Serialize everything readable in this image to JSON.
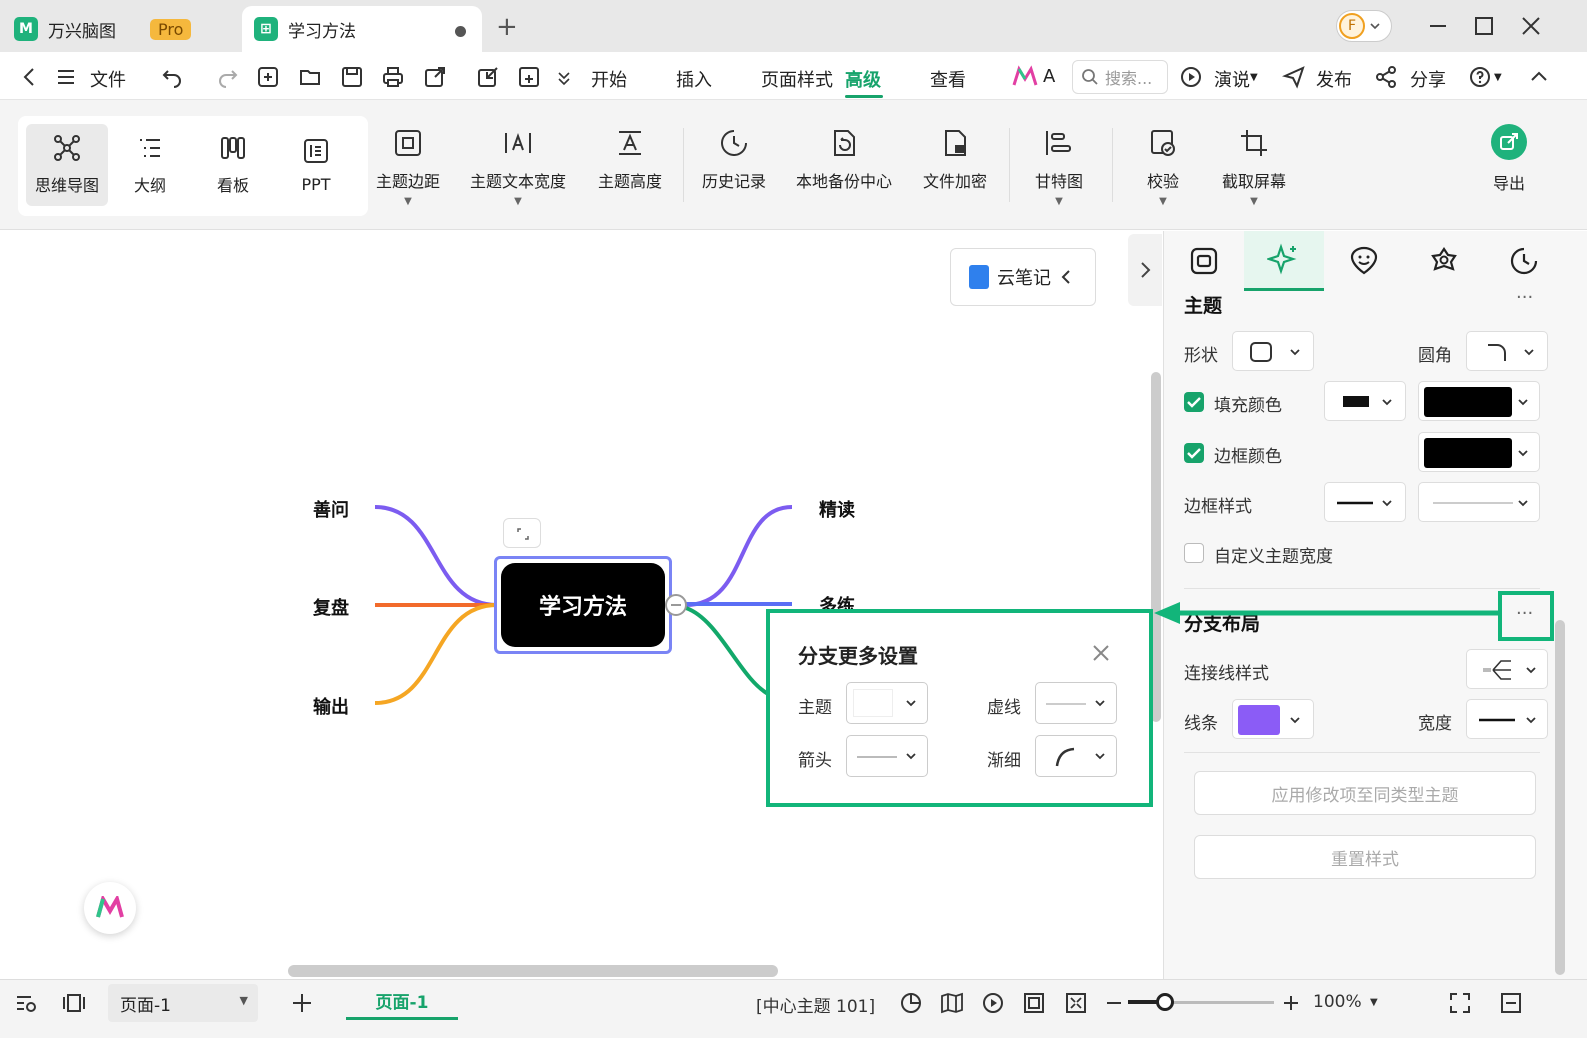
{
  "titlebar": {
    "home_tab": "万兴脑图",
    "pro_badge": "Pro",
    "doc_tab": "学习方法",
    "avatar_initial": "F"
  },
  "menubar": {
    "file": "文件",
    "tabs": [
      "开始",
      "插入",
      "页面样式",
      "高级",
      "查看"
    ],
    "active_tab": "高级",
    "ai_label": "A",
    "search_placeholder": "搜索...",
    "present": "演说",
    "publish": "发布",
    "share": "分享"
  },
  "ribbon": {
    "views": [
      "思维导图",
      "大纲",
      "看板",
      "PPT"
    ],
    "tools": [
      "主题边距",
      "主题文本宽度",
      "主题高度",
      "历史记录",
      "本地备份中心",
      "文件加密",
      "甘特图",
      "校验",
      "截取屏幕"
    ],
    "export": "导出"
  },
  "canvas": {
    "cloud_note": "云笔记",
    "central_topic": "学习方法",
    "branches_left": [
      "善问",
      "复盘",
      "输出"
    ],
    "branches_right": [
      "精读",
      "多练"
    ],
    "branch_colors": {
      "善问": "#7c5cf0",
      "复盘": "#f26b2b",
      "输出": "#f5a623",
      "精读": "#7c5cf0",
      "多练": "#5b6ef5",
      "third": "#12a86a"
    }
  },
  "popup": {
    "title": "分支更多设置",
    "topic_label": "主题",
    "dash_label": "虚线",
    "arrow_label": "箭头",
    "taper_label": "渐细"
  },
  "panel": {
    "topic_section": "主题",
    "shape_label": "形状",
    "corner_label": "圆角",
    "fill_color_label": "填充颜色",
    "border_color_label": "边框颜色",
    "border_style_label": "边框样式",
    "custom_width_label": "自定义主题宽度",
    "branch_section": "分支布局",
    "connector_style_label": "连接线样式",
    "line_label": "线条",
    "width_label": "宽度",
    "line_color": "#8b5cf6",
    "apply_button": "应用修改项至同类型主题",
    "reset_button": "重置样式"
  },
  "statusbar": {
    "page_select": "页面-1",
    "page_tab": "页面-1",
    "topic_count": "[中心主题 101]",
    "zoom": "100%",
    "zoom_level": 0.25
  }
}
